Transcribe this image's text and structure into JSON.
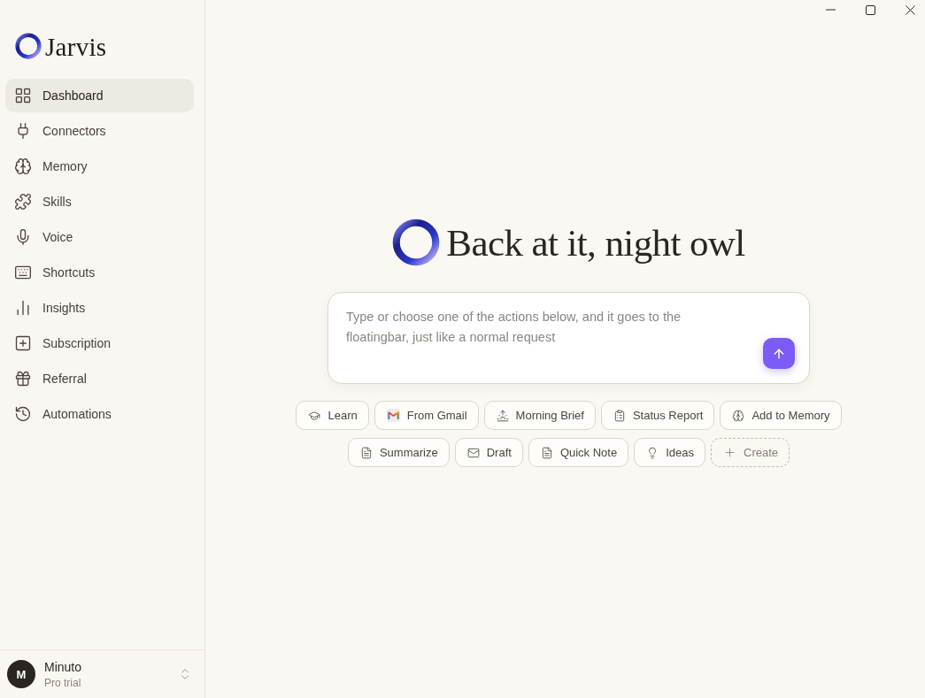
{
  "sidebar": {
    "app_name": "Jarvis",
    "items": [
      {
        "label": "Dashboard",
        "selected": true
      },
      {
        "label": "Connectors",
        "selected": false
      },
      {
        "label": "Memory",
        "selected": false
      },
      {
        "label": "Skills",
        "selected": false
      },
      {
        "label": "Voice",
        "selected": false
      },
      {
        "label": "Shortcuts",
        "selected": false
      },
      {
        "label": "Insights",
        "selected": false
      },
      {
        "label": "Subscription",
        "selected": false
      },
      {
        "label": "Referral",
        "selected": false
      },
      {
        "label": "Automations",
        "selected": false
      }
    ],
    "user": {
      "initial": "M",
      "name": "Minuto",
      "plan": "Pro trial"
    }
  },
  "main": {
    "greeting": "Back at it, night owl",
    "prompt": {
      "placeholder": "Type or choose one of the actions below, and it goes to the floatingbar, just like a normal request"
    },
    "action_rows": [
      {
        "actions": [
          {
            "label": "Learn",
            "kind": "action"
          },
          {
            "label": "From Gmail",
            "kind": "action"
          },
          {
            "label": "Morning Brief",
            "kind": "action"
          },
          {
            "label": "Status Report",
            "kind": "action"
          },
          {
            "label": "Add to Memory",
            "kind": "action"
          }
        ]
      },
      {
        "actions": [
          {
            "label": "Summarize",
            "kind": "action"
          },
          {
            "label": "Draft",
            "kind": "action"
          },
          {
            "label": "Quick Note",
            "kind": "action"
          },
          {
            "label": "Ideas",
            "kind": "action"
          },
          {
            "label": "Create",
            "kind": "create"
          }
        ]
      }
    ]
  }
}
